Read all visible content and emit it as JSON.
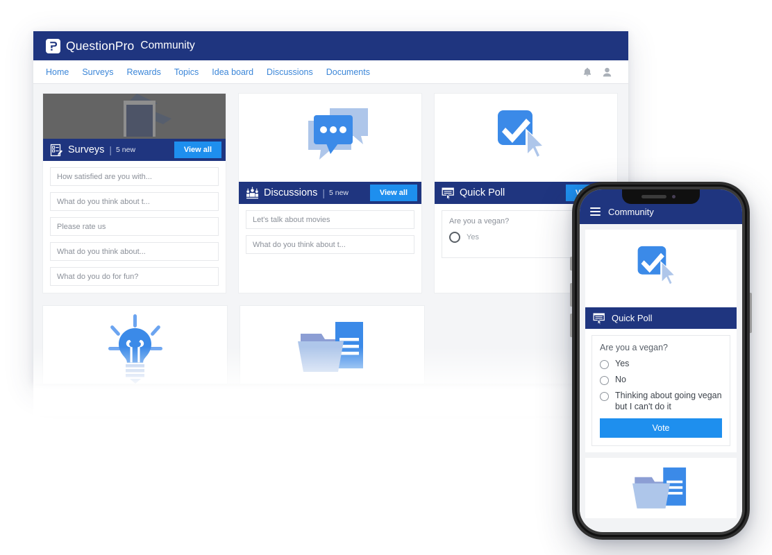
{
  "brand": {
    "logo_icon": "questionpro-p-logo",
    "name": "QuestionPro",
    "product": "Community"
  },
  "nav": {
    "links": [
      {
        "label": "Home"
      },
      {
        "label": "Surveys"
      },
      {
        "label": "Rewards"
      },
      {
        "label": "Topics"
      },
      {
        "label": "Idea board"
      },
      {
        "label": "Discussions"
      },
      {
        "label": "Documents"
      }
    ],
    "bell_icon": "notification-bell-icon",
    "account_icon": "user-account-icon"
  },
  "cards": {
    "surveys": {
      "icon": "survey-clipboard-icon",
      "media_icon": "survey-papers-illustration",
      "title": "Surveys",
      "separator": "|",
      "new_count": "5 new",
      "view_all": "View all",
      "items": [
        "How satisfied are you with...",
        "What do you think about t...",
        "Please rate us",
        "What do you think about...",
        "What do you do for fun?"
      ]
    },
    "discussions": {
      "icon": "discussion-people-icon",
      "media_icon": "speech-bubbles-illustration",
      "title": "Discussions",
      "separator": "|",
      "new_count": "5 new",
      "view_all": "View all",
      "items": [
        "Let's talk about movies",
        "What do you think about t..."
      ]
    },
    "quickpoll": {
      "icon": "poll-click-icon",
      "media_icon": "checkbox-cursor-illustration",
      "title": "Quick Poll",
      "view_all": "View all",
      "question": "Are you a vegan?",
      "options": [
        "Yes"
      ]
    },
    "ideaboard": {
      "media_icon": "lightbulb-illustration"
    },
    "documents": {
      "media_icon": "folder-document-illustration"
    }
  },
  "phone": {
    "menu_icon": "hamburger-menu-icon",
    "title": "Community",
    "quickpoll": {
      "icon": "poll-click-icon",
      "media_icon": "checkbox-cursor-illustration",
      "title": "Quick Poll",
      "question": "Are you a vegan?",
      "options": [
        "Yes",
        "No",
        "Thinking about going vegan but I can't do it"
      ],
      "vote_label": "Vote"
    },
    "documents": {
      "media_icon": "folder-document-illustration"
    }
  },
  "colors": {
    "brand_navy": "#1f357f",
    "accent_blue": "#1e8fee",
    "nav_link": "#3b86d8",
    "page_bg": "#f4f5f7",
    "icon_light_blue": "#aec6ea",
    "icon_blue": "#4a90e8"
  }
}
